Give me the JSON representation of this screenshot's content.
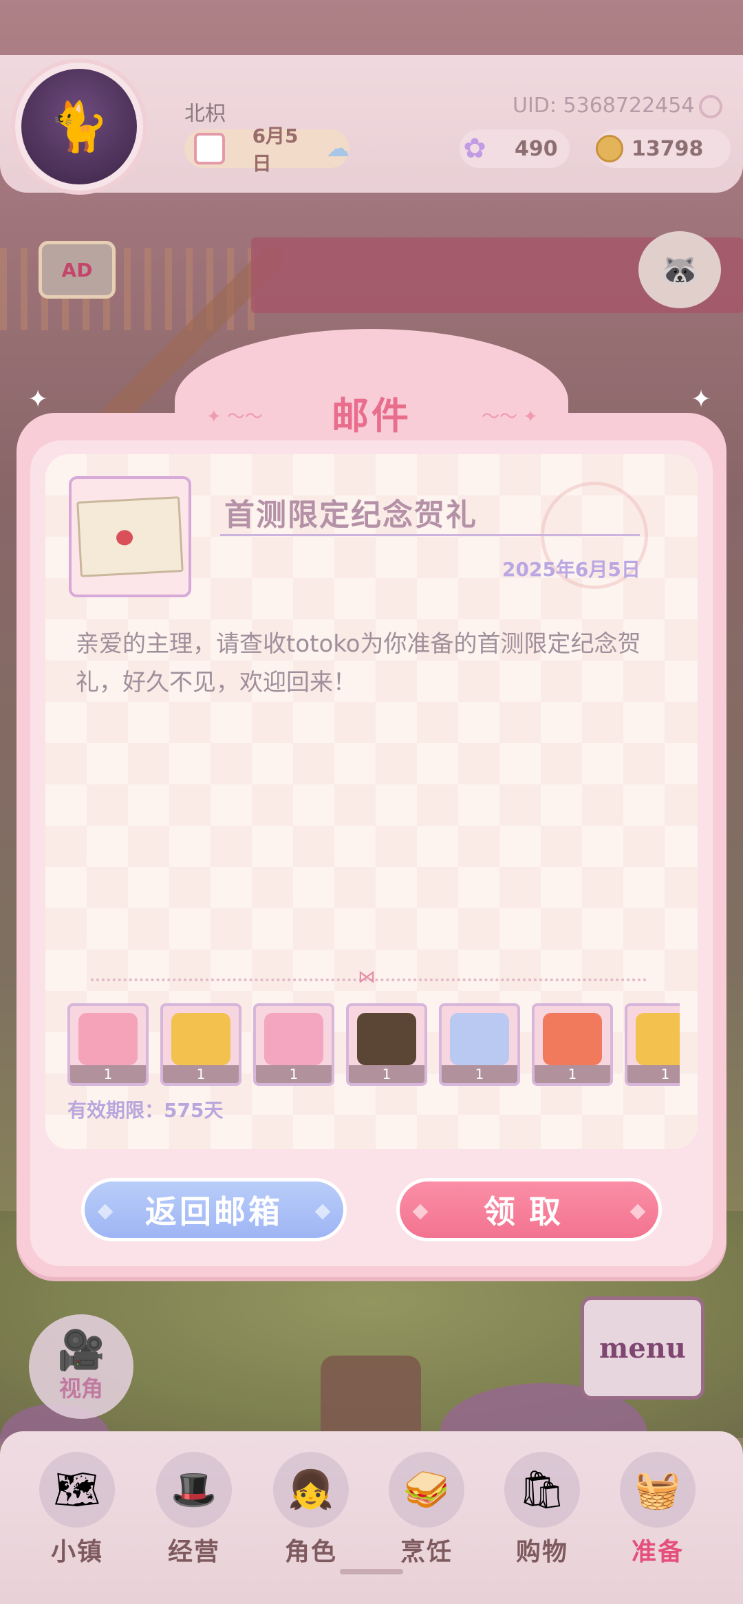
{
  "player": {
    "name": "北枳",
    "uid": "UID: 5368722454",
    "date": "6月5日"
  },
  "currency": {
    "gems": "490",
    "coins": "13798"
  },
  "side": {
    "ad_label": "AD"
  },
  "mail": {
    "window_title": "邮件",
    "title": "首测限定纪念贺礼",
    "date": "2025年6月5日",
    "body": "亲爱的主理，请查收totoko为你准备的首测限定纪念贺礼，好久不见，欢迎回来！",
    "rewards": [
      {
        "icon": "bed-icon",
        "count": "1",
        "color": "#f5a3b8"
      },
      {
        "icon": "wreath-icon",
        "count": "1",
        "color": "#f2c14e"
      },
      {
        "icon": "pink-dress-icon",
        "count": "1",
        "color": "#f4a6c0"
      },
      {
        "icon": "maid-dress-icon",
        "count": "1",
        "color": "#5b4636"
      },
      {
        "icon": "cat-outfit-icon",
        "count": "1",
        "color": "#b9c9f2"
      },
      {
        "icon": "flower-hair-icon",
        "count": "1",
        "color": "#f17a5c"
      },
      {
        "icon": "flower-hair-icon",
        "count": "1",
        "color": "#f2c14e"
      }
    ],
    "expiry": "有效期限：575天",
    "back_button": "返回邮箱",
    "claim_button": "领取"
  },
  "view_button": "视角",
  "menu_label": "menu",
  "nav": [
    {
      "label": "小镇",
      "icon": "map-icon"
    },
    {
      "label": "经营",
      "icon": "locked-hat-icon"
    },
    {
      "label": "角色",
      "icon": "character-icon"
    },
    {
      "label": "烹饪",
      "icon": "sandwich-icon"
    },
    {
      "label": "购物",
      "icon": "shopping-bag-icon"
    },
    {
      "label": "准备",
      "icon": "basket-icon"
    }
  ],
  "colors": {
    "accent": "#e96d8c",
    "dialog": "#f8cdd8",
    "claim": "#f27390",
    "back": "#9fb5f4"
  }
}
